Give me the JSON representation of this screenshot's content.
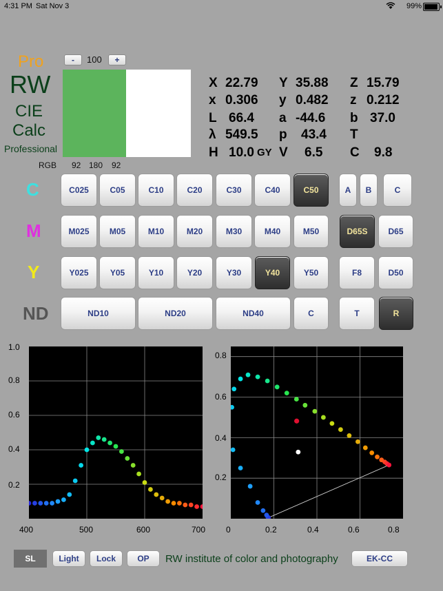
{
  "status": {
    "time": "4:31 PM",
    "date": "Sat Nov 3",
    "battery": "99%"
  },
  "title": {
    "pro": "Pro",
    "rw": "RW",
    "cie": "CIE",
    "calc": "Calc",
    "professional": "Professional"
  },
  "stepper": {
    "minus": "-",
    "value": "100",
    "plus": "+"
  },
  "swatch": {
    "rgb_label": "RGB",
    "r": "92",
    "g": "180",
    "b": "92",
    "color": "#5cb45c"
  },
  "measure": {
    "X": "X",
    "X_val": "22.79",
    "Y": "Y",
    "Y_val": "35.88",
    "Z": "Z",
    "Z_val": "15.79",
    "x": "x",
    "x_val": "0.306",
    "y": "y",
    "y_val": "0.482",
    "z": "z",
    "z_val": "0.212",
    "L": "L",
    "L_val": "66.4",
    "a": "a",
    "a_val": "-44.6",
    "b": "b",
    "b_val": "37.0",
    "lam": "λ",
    "lam_val": "549.5",
    "p": "p",
    "p_val": "43.4",
    "T": "T",
    "H": "H",
    "H_val": "10.0",
    "H_unit": "GY",
    "V": "V",
    "V_val": "6.5",
    "C": "C",
    "C_val": "9.8"
  },
  "rows": {
    "C": {
      "label": "C",
      "color": "#3ee0e0",
      "buttons": [
        "C025",
        "C05",
        "C10",
        "C20",
        "C30",
        "C40",
        "C50"
      ]
    },
    "M": {
      "label": "M",
      "color": "#e030e0",
      "buttons": [
        "M025",
        "M05",
        "M10",
        "M20",
        "M30",
        "M40",
        "M50"
      ]
    },
    "Y": {
      "label": "Y",
      "color": "#f2ea1a",
      "buttons": [
        "Y025",
        "Y05",
        "Y10",
        "Y20",
        "Y30",
        "Y40",
        "Y50"
      ]
    },
    "ND": {
      "label": "ND",
      "color": "#555555",
      "buttons": [
        "ND10",
        "ND20",
        "ND40",
        "C"
      ]
    }
  },
  "illum": {
    "A": "A",
    "B": "B",
    "C": "C",
    "D65S": "D65S",
    "D65": "D65",
    "F8": "F8",
    "D50": "D50",
    "T": "T",
    "R": "R"
  },
  "plot_left": {
    "y_ticks": [
      "1.0",
      "0.8",
      "0.6",
      "0.4",
      "0.2"
    ],
    "x_ticks": [
      "400",
      "500",
      "600",
      "700"
    ]
  },
  "plot_right": {
    "y_ticks": [
      "0.8",
      "0.6",
      "0.4",
      "0.2"
    ],
    "x_ticks": [
      "0",
      "0.2",
      "0.4",
      "0.6",
      "0.8"
    ]
  },
  "chart_data": [
    {
      "type": "scatter",
      "xlim": [
        400,
        700
      ],
      "ylim": [
        0,
        1.0
      ],
      "grid": true,
      "x": [
        400,
        410,
        420,
        430,
        440,
        450,
        460,
        470,
        480,
        490,
        500,
        510,
        520,
        530,
        540,
        550,
        560,
        570,
        580,
        590,
        600,
        610,
        620,
        630,
        640,
        650,
        660,
        670,
        680,
        690,
        700
      ],
      "y": [
        0.09,
        0.09,
        0.09,
        0.09,
        0.09,
        0.1,
        0.11,
        0.14,
        0.22,
        0.31,
        0.4,
        0.44,
        0.47,
        0.46,
        0.44,
        0.42,
        0.39,
        0.35,
        0.31,
        0.26,
        0.21,
        0.17,
        0.14,
        0.12,
        0.1,
        0.09,
        0.09,
        0.08,
        0.08,
        0.07,
        0.07
      ]
    },
    {
      "type": "scatter",
      "xlim": [
        0,
        0.8
      ],
      "ylim": [
        0,
        0.85
      ],
      "grid": true,
      "locus_x": [
        0.175,
        0.172,
        0.166,
        0.15,
        0.125,
        0.09,
        0.045,
        0.01,
        0.005,
        0.015,
        0.045,
        0.08,
        0.125,
        0.17,
        0.215,
        0.26,
        0.305,
        0.345,
        0.39,
        0.43,
        0.47,
        0.51,
        0.55,
        0.59,
        0.625,
        0.655,
        0.68,
        0.7,
        0.715,
        0.725,
        0.735
      ],
      "locus_y": [
        0.005,
        0.008,
        0.018,
        0.04,
        0.08,
        0.16,
        0.25,
        0.34,
        0.55,
        0.64,
        0.69,
        0.71,
        0.7,
        0.68,
        0.65,
        0.62,
        0.59,
        0.56,
        0.53,
        0.5,
        0.47,
        0.44,
        0.41,
        0.38,
        0.35,
        0.325,
        0.305,
        0.29,
        0.28,
        0.272,
        0.265
      ],
      "sample_point": [
        0.306,
        0.482
      ],
      "white_point": [
        0.313,
        0.329
      ]
    }
  ],
  "bottom": {
    "sl": "SL",
    "light": "Light",
    "lock": "Lock",
    "op": "OP",
    "institute": "RW institute of color and photography",
    "ekcc": "EK-CC"
  }
}
